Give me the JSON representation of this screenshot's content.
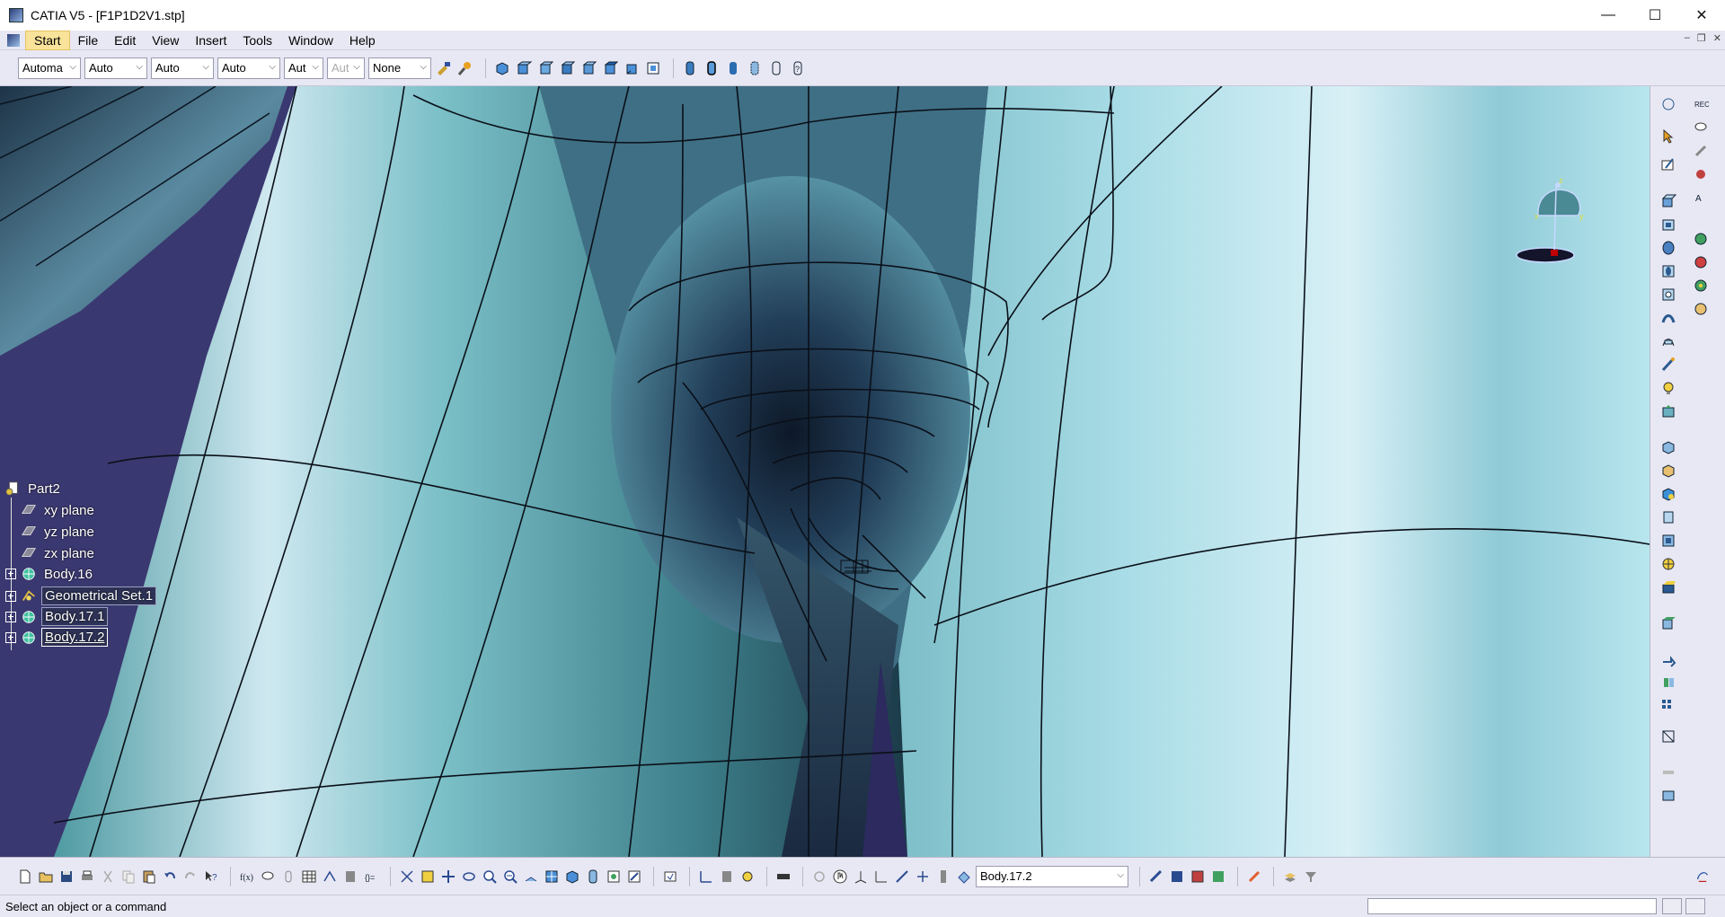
{
  "window": {
    "title": "CATIA V5 - [F1P1D2V1.stp]",
    "minimize": "—",
    "maximize": "☐",
    "close": "✕"
  },
  "menu": {
    "items": [
      {
        "label": "Start"
      },
      {
        "label": "File"
      },
      {
        "label": "Edit"
      },
      {
        "label": "View"
      },
      {
        "label": "Insert"
      },
      {
        "label": "Tools"
      },
      {
        "label": "Window"
      },
      {
        "label": "Help"
      }
    ],
    "mdi_minimize": "–",
    "mdi_restore": "❐",
    "mdi_close": "✕"
  },
  "graphic_properties": {
    "color": "Automa",
    "transparency": "Auto",
    "line_thickness": "Auto",
    "line_type": "Auto",
    "point_type": "Aut",
    "rendering": "Aut",
    "layer": "None"
  },
  "spec_tree": {
    "root": "Part2",
    "nodes": [
      {
        "label": "xy plane",
        "icon": "plane-icon"
      },
      {
        "label": "yz plane",
        "icon": "plane-icon"
      },
      {
        "label": "zx plane",
        "icon": "plane-icon"
      },
      {
        "label": "Body.16",
        "icon": "body-icon"
      },
      {
        "label": "Geometrical Set.1",
        "icon": "geometrical-set-icon"
      },
      {
        "label": "Body.17.1",
        "icon": "body-icon"
      },
      {
        "label": "Body.17.2",
        "icon": "body-icon"
      }
    ]
  },
  "current_body": "Body.17.2",
  "status": {
    "message": "Select an object or a command"
  },
  "colors": {
    "toolbar_bg": "#e8e8f4",
    "viewport_bg": "#3a3870",
    "active_menu": "#f9e39a"
  }
}
